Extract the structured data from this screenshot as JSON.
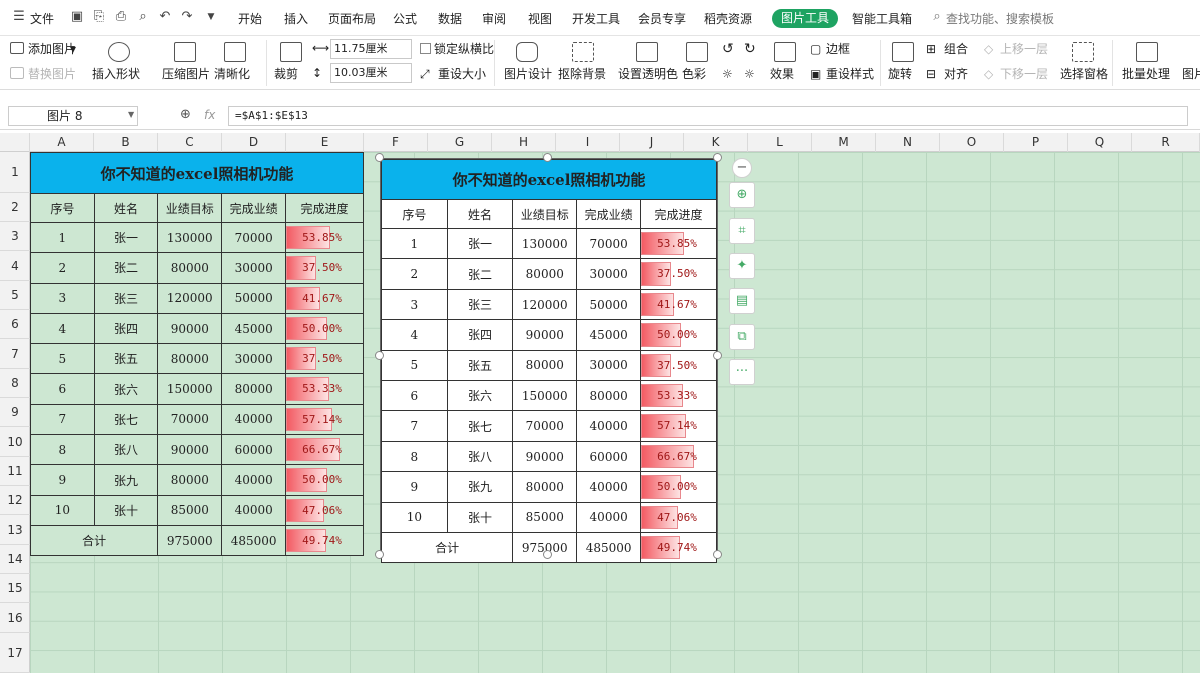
{
  "menu": {
    "file": "文件",
    "tabs": [
      "开始",
      "插入",
      "页面布局",
      "公式",
      "数据",
      "审阅",
      "视图",
      "开发工具",
      "会员专享",
      "稻壳资源"
    ],
    "active_tab": "图片工具",
    "extra_tab": "智能工具箱",
    "search": "查找功能、搜索模板",
    "active_color": "#1ea362"
  },
  "ribbon": {
    "add_picture": "添加图片",
    "replace_picture": "替换图片",
    "insert_shape": "插入形状",
    "compress": "压缩图片",
    "sharpen": "清晰化",
    "crop": "裁剪",
    "width": "11.75厘米",
    "height": "10.03厘米",
    "lock_ratio": "锁定纵横比",
    "reset_size": "重设大小",
    "picture_design": "图片设计",
    "remove_bg": "抠除背景",
    "set_transparent": "设置透明色",
    "color": "色彩",
    "effects": "效果",
    "border": "边框",
    "reset_style": "重设样式",
    "rotate": "旋转",
    "group": "组合",
    "align": "对齐",
    "bring_forward": "上移一层",
    "send_backward": "下移一层",
    "selection_pane": "选择窗格",
    "batch": "批量处理",
    "more": "图片"
  },
  "formula_bar": {
    "name_box": "图片 8",
    "fx": "fx",
    "formula": "=$A$1:$E$13"
  },
  "columns": [
    "A",
    "B",
    "C",
    "D",
    "E",
    "F",
    "G",
    "H",
    "I",
    "J",
    "K",
    "L",
    "M",
    "N",
    "O",
    "P",
    "Q",
    "R"
  ],
  "rows": [
    "1",
    "2",
    "3",
    "4",
    "5",
    "6",
    "7",
    "8",
    "9",
    "10",
    "11",
    "12",
    "13",
    "14",
    "15",
    "16",
    "17"
  ],
  "table": {
    "title": "你不知道的excel照相机功能",
    "headers": [
      "序号",
      "姓名",
      "业绩目标",
      "完成业绩",
      "完成进度"
    ],
    "data": [
      {
        "no": "1",
        "name": "张一",
        "target": "130000",
        "done": "70000",
        "pct": "53.85%",
        "frac": 0.5385
      },
      {
        "no": "2",
        "name": "张二",
        "target": "80000",
        "done": "30000",
        "pct": "37.50%",
        "frac": 0.375
      },
      {
        "no": "3",
        "name": "张三",
        "target": "120000",
        "done": "50000",
        "pct": "41.67%",
        "frac": 0.4167
      },
      {
        "no": "4",
        "name": "张四",
        "target": "90000",
        "done": "45000",
        "pct": "50.00%",
        "frac": 0.5
      },
      {
        "no": "5",
        "name": "张五",
        "target": "80000",
        "done": "30000",
        "pct": "37.50%",
        "frac": 0.375
      },
      {
        "no": "6",
        "name": "张六",
        "target": "150000",
        "done": "80000",
        "pct": "53.33%",
        "frac": 0.5333
      },
      {
        "no": "7",
        "name": "张七",
        "target": "70000",
        "done": "40000",
        "pct": "57.14%",
        "frac": 0.5714
      },
      {
        "no": "8",
        "name": "张八",
        "target": "90000",
        "done": "60000",
        "pct": "66.67%",
        "frac": 0.6667
      },
      {
        "no": "9",
        "name": "张九",
        "target": "80000",
        "done": "40000",
        "pct": "50.00%",
        "frac": 0.5
      },
      {
        "no": "10",
        "name": "张十",
        "target": "85000",
        "done": "40000",
        "pct": "47.06%",
        "frac": 0.4706
      }
    ],
    "total": {
      "label": "合计",
      "target": "975000",
      "done": "485000",
      "pct": "49.74%",
      "frac": 0.4974
    }
  },
  "side_toolbar": [
    "minus-icon",
    "zoom-in-icon",
    "crop-icon",
    "bulb-icon",
    "convert-image-icon",
    "copy-image-icon",
    "more-icon"
  ],
  "colors": {
    "title_bg": "#0ab2ec",
    "sheet_bg": "#cde7d2",
    "bar": "#f35b63"
  }
}
